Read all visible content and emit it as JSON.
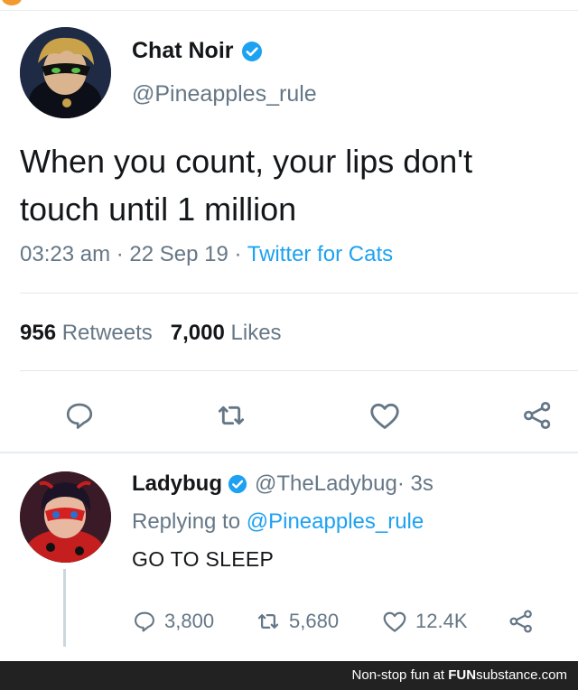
{
  "tweet": {
    "display_name": "Chat Noir",
    "handle": "@Pineapples_rule",
    "text_line1": "When you count, your lips don't",
    "text_line2": "touch until 1 million",
    "time": "03:23 am",
    "sep1": " · ",
    "date": "22 Sep 19",
    "sep2": " · ",
    "source": "Twitter for Cats",
    "retweets_count": "956",
    "retweets_label": "Retweets",
    "likes_count": "7,000",
    "likes_label": "Likes"
  },
  "reply": {
    "display_name": "Ladybug",
    "handle": "@TheLadybug",
    "time": " · 3s",
    "replying_prefix": "Replying to ",
    "replying_to": "@Pineapples_rule",
    "text": "GO TO SLEEP",
    "reply_count": "3,800",
    "retweet_count": "5,680",
    "like_count": "12.4K"
  },
  "footer": {
    "prefix": "Non-stop fun at ",
    "brand_bold": "FUN",
    "brand_rest": "substance",
    "suffix": ".com"
  },
  "colors": {
    "accent": "#1da1f2",
    "muted": "#657786",
    "text": "#14171a",
    "footer_bg": "#222222"
  },
  "icons": [
    "verified-badge-icon",
    "reply-icon",
    "retweet-icon",
    "like-icon",
    "share-icon"
  ]
}
